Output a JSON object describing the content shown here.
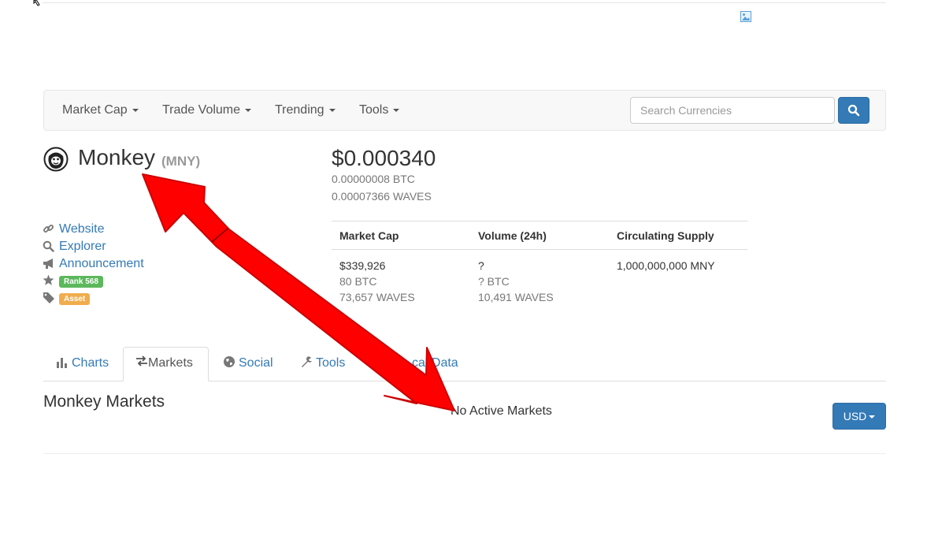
{
  "nav": {
    "items": [
      {
        "label": "Market Cap"
      },
      {
        "label": "Trade Volume"
      },
      {
        "label": "Trending"
      },
      {
        "label": "Tools"
      }
    ],
    "search_placeholder": "Search Currencies"
  },
  "coin": {
    "name": "Monkey",
    "symbol": "(MNY)",
    "price_usd": "$0.000340",
    "price_btc": "0.00000008 BTC",
    "price_waves": "0.00007366 WAVES"
  },
  "links": {
    "website": "Website",
    "explorer": "Explorer",
    "announcement": "Announcement",
    "rank_badge": "Rank 568",
    "type_badge": "Asset"
  },
  "stats": {
    "market_cap": {
      "label": "Market Cap",
      "usd": "$339,926",
      "btc": "80 BTC",
      "waves": "73,657 WAVES"
    },
    "volume": {
      "label": "Volume (24h)",
      "usd": "?",
      "btc": "? BTC",
      "waves": "10,491 WAVES"
    },
    "supply": {
      "label": "Circulating Supply",
      "value": "1,000,000,000 MNY"
    }
  },
  "tabs": [
    {
      "label": "Charts"
    },
    {
      "label": "Markets",
      "active": true
    },
    {
      "label": "Social"
    },
    {
      "label": "Tools"
    },
    {
      "label": "cal Data"
    }
  ],
  "markets": {
    "title": "Monkey Markets",
    "empty_text": "No Active Markets",
    "currency_button": "USD"
  },
  "colors": {
    "link": "#337ab7",
    "primary_button": "#337ab7",
    "rank_badge": "#5cb85c",
    "asset_badge": "#f0ad4e",
    "annotation_arrow": "#ff0000"
  }
}
